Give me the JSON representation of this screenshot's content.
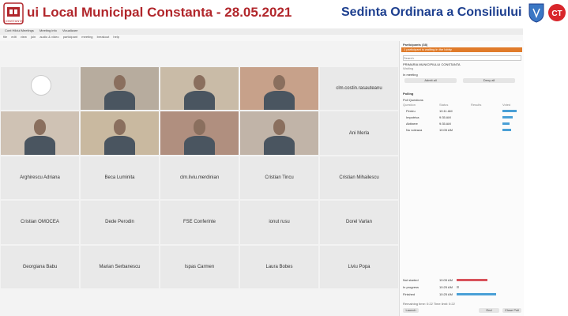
{
  "banner": {
    "title_left": "ui Local Municipal Constanta - 28.05.2021",
    "title_right": "Sedinta Ordinara a Consiliului",
    "logo_text": "CT"
  },
  "teams": {
    "topbar_items": [
      "Cont Hildul Meetings",
      "Meeting info",
      "Vizualizare"
    ],
    "menu_items": [
      "file",
      "edit",
      "view",
      "join",
      "audio & video",
      "participant",
      "meeting",
      "breakout",
      "help"
    ],
    "participants_panel": {
      "header": "Participants (38)",
      "banner_text": "1 participant is waiting in the lobby",
      "search_placeholder": "Search",
      "lobby_label": "PRIMARIA MUNICIPIULUI CONSTANTA",
      "lobby_sub": "Waiting",
      "in_meeting_label": "In meeting",
      "admit_all": "Admit all",
      "deny_all": "Deny all",
      "polls_header": "Polling",
      "poll_title": "Poll Questions",
      "columns": [
        "Question",
        "Status",
        "Results",
        "Voted"
      ],
      "poll_rows": [
        {
          "q": "Pentru",
          "status": "10:11 AM",
          "fill": 0.8
        },
        {
          "q": "Impotriva",
          "status": "9:35 AM",
          "fill": 0.6
        },
        {
          "q": "Abtinere",
          "status": "9:35 AM",
          "fill": 0.4
        },
        {
          "q": "Nu voteaza",
          "status": "10:05 AM",
          "fill": 0.5
        }
      ],
      "status_rows": [
        {
          "label": "Not started",
          "time": "10:05 AM",
          "color": "#d8525b",
          "fill": 0.7
        },
        {
          "label": "In progress",
          "time": "10:25 AM",
          "color": "#bbb",
          "fill": 0.05
        },
        {
          "label": "Finished",
          "time": "10:25 AM",
          "color": "#4aa0d6",
          "fill": 0.9
        }
      ],
      "footer": "Remaining time: 0:22  Time limit: 0:22",
      "footer_buttons": [
        "Launch",
        "End",
        "Close Poll"
      ]
    },
    "tiles": [
      {
        "name": "",
        "type": "avatar"
      },
      {
        "name": "",
        "type": "video"
      },
      {
        "name": "",
        "type": "video"
      },
      {
        "name": "",
        "type": "video"
      },
      {
        "name": "clm.costin.rasauteanu",
        "type": "name"
      },
      {
        "name": "",
        "type": "video"
      },
      {
        "name": "",
        "type": "video"
      },
      {
        "name": "",
        "type": "video"
      },
      {
        "name": "",
        "type": "video"
      },
      {
        "name": "Ani Merla",
        "type": "name"
      },
      {
        "name": "Arghirescu Adriana",
        "type": "name"
      },
      {
        "name": "Beca Luminita",
        "type": "name"
      },
      {
        "name": "clm.liviu.merdinian",
        "type": "name"
      },
      {
        "name": "Cristian Tincu",
        "type": "name"
      },
      {
        "name": "Cristian Mihailescu",
        "type": "name"
      },
      {
        "name": "Cristian OMOCEA",
        "type": "name"
      },
      {
        "name": "Dede Perodin",
        "type": "name"
      },
      {
        "name": "FSE Conferinte",
        "type": "name"
      },
      {
        "name": "ionut rusu",
        "type": "name"
      },
      {
        "name": "Dorel Varlan",
        "type": "name"
      },
      {
        "name": "Georgiana Babu",
        "type": "name"
      },
      {
        "name": "Marian Serbanescu",
        "type": "name"
      },
      {
        "name": "Ispas Carmen",
        "type": "name"
      },
      {
        "name": "Laura Bobes",
        "type": "name"
      },
      {
        "name": "Liviu Popa",
        "type": "name"
      }
    ],
    "colors": {
      "banner_red": "#b1262b",
      "banner_blue": "#1d3f8f",
      "lobby_orange": "#e07b2a",
      "tile_bg": "#e9e9e9"
    }
  }
}
